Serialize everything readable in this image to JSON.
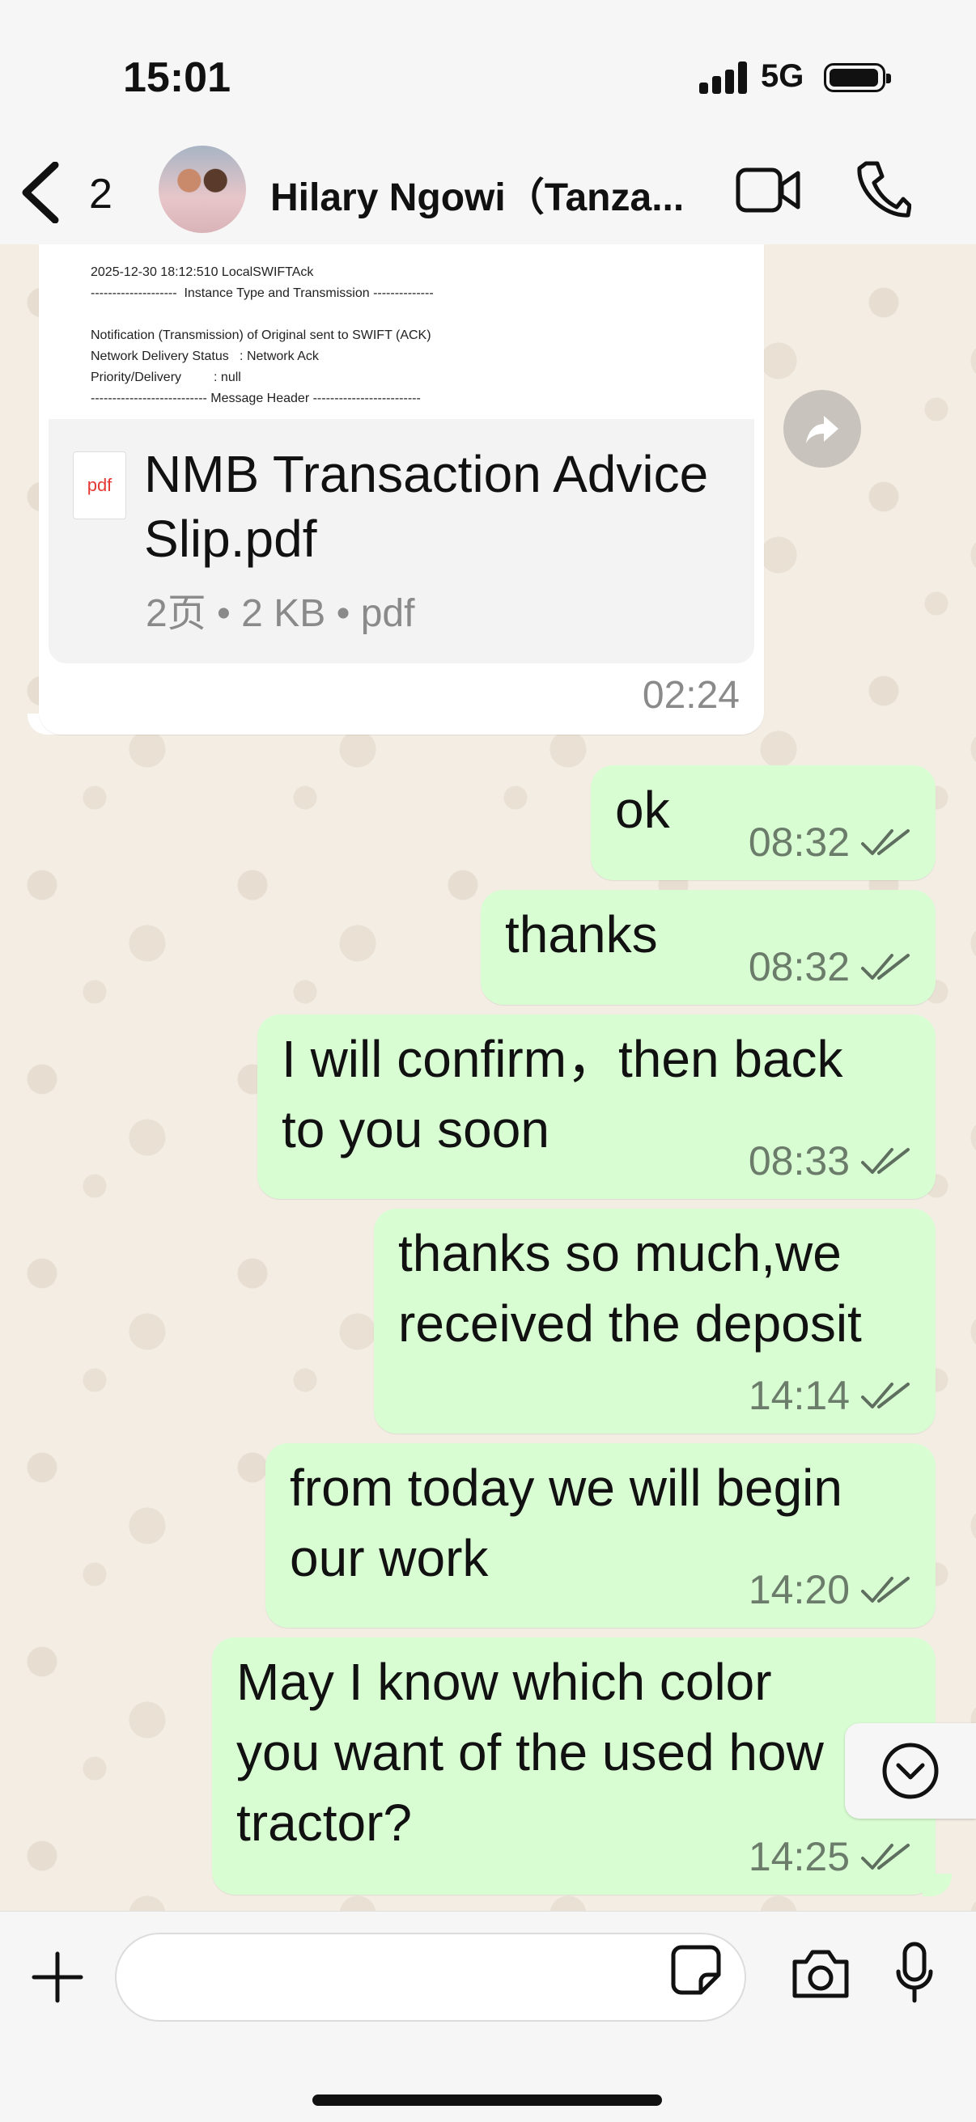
{
  "status_bar": {
    "time": "15:01",
    "network": "5G"
  },
  "header": {
    "back_count": "2",
    "contact_name": "Hilary Ngowi（Tanza..."
  },
  "incoming_document": {
    "preview_lines": [
      "2025-12-30 18:12:510 LocalSWIFTAck",
      "--------------------  Instance Type and Transmission --------------",
      "",
      "Notification (Transmission) of Original sent to SWIFT (ACK)",
      "Network Delivery Status   : Network Ack",
      "Priority/Delivery         : null",
      "--------------------------- Message Header -------------------------"
    ],
    "file_type_label": "pdf",
    "file_name": "NMB Transaction Advice Slip.pdf",
    "file_meta": "2页 • 2 KB • pdf",
    "time": "02:24"
  },
  "outgoing_messages": [
    {
      "text": "ok",
      "time": "08:32"
    },
    {
      "text": "thanks",
      "time": "08:32"
    },
    {
      "text": "I will confirm，then back\nto you soon",
      "time": "08:33"
    },
    {
      "text": "thanks so much,we\nreceived the deposit",
      "time": "14:14"
    },
    {
      "text": "from today we will begin\nour work",
      "time": "14:20"
    },
    {
      "text": "May I know which color\nyou want of the used how\ntractor?",
      "time": "14:25"
    }
  ],
  "input": {
    "placeholder": ""
  }
}
